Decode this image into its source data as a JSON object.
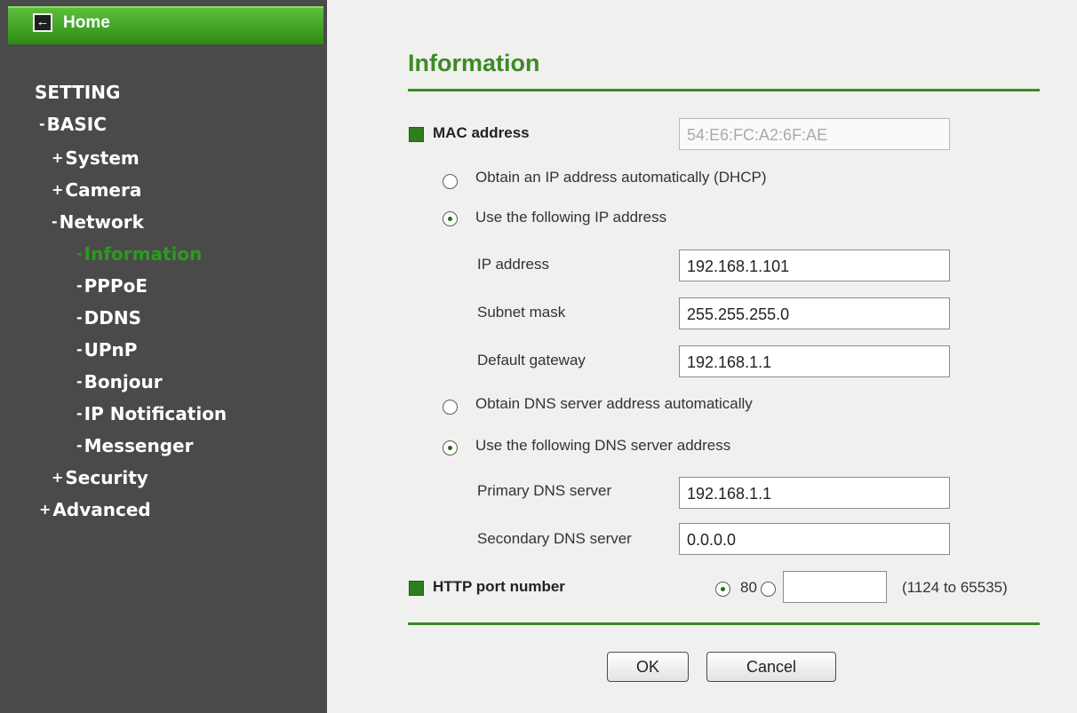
{
  "sidebar": {
    "home": "Home",
    "items": [
      {
        "label": "SETTING",
        "prefix": ""
      },
      {
        "label": "BASIC",
        "prefix": "-"
      },
      {
        "label": "System",
        "prefix": "+"
      },
      {
        "label": "Camera",
        "prefix": "+"
      },
      {
        "label": "Network",
        "prefix": "-"
      },
      {
        "label": "Information",
        "prefix": "-",
        "active": true
      },
      {
        "label": "PPPoE",
        "prefix": "-"
      },
      {
        "label": "DDNS",
        "prefix": "-"
      },
      {
        "label": "UPnP",
        "prefix": "-"
      },
      {
        "label": "Bonjour",
        "prefix": "-"
      },
      {
        "label": "IP Notification",
        "prefix": "-"
      },
      {
        "label": "Messenger",
        "prefix": "-"
      },
      {
        "label": "Security",
        "prefix": "+"
      },
      {
        "label": "Advanced",
        "prefix": "+"
      }
    ]
  },
  "main": {
    "title": "Information",
    "mac": {
      "label": "MAC address",
      "value": "54:E6:FC:A2:6F:AE"
    },
    "ip_mode": {
      "dhcp_label": "Obtain an IP address automatically (DHCP)",
      "static_label": "Use the following IP address",
      "selected": "static"
    },
    "ip_address": {
      "label": "IP address",
      "value": "192.168.1.101"
    },
    "subnet_mask": {
      "label": "Subnet mask",
      "value": "255.255.255.0"
    },
    "gateway": {
      "label": "Default gateway",
      "value": "192.168.1.1"
    },
    "dns_mode": {
      "auto_label": "Obtain DNS server address automatically",
      "static_label": "Use the following DNS server address",
      "selected": "static"
    },
    "primary_dns": {
      "label": "Primary DNS server",
      "value": "192.168.1.1"
    },
    "secondary_dns": {
      "label": "Secondary DNS server",
      "value": "0.0.0.0"
    },
    "http_port": {
      "label": "HTTP port number",
      "default_option": "80",
      "custom_value": "",
      "range_hint": "(1124 to 65535)",
      "selected": "default"
    },
    "buttons": {
      "ok": "OK",
      "cancel": "Cancel"
    }
  },
  "colors": {
    "sidebar_bg": "#4a4a4a",
    "accent_green": "#3a8a28",
    "active_item": "#2c9a1f",
    "panel_bg": "#f0f0ee"
  }
}
